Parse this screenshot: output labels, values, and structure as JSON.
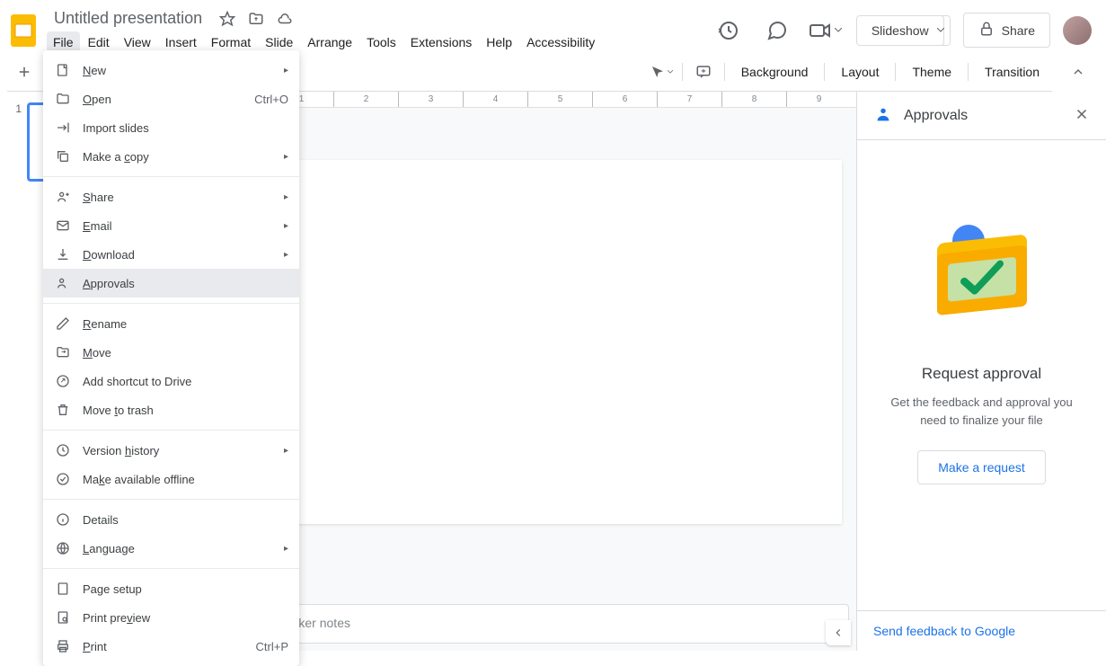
{
  "doc": {
    "title": "Untitled presentation"
  },
  "menubar": {
    "items": [
      "File",
      "Edit",
      "View",
      "Insert",
      "Format",
      "Slide",
      "Arrange",
      "Tools",
      "Extensions",
      "Help",
      "Accessibility"
    ]
  },
  "header_buttons": {
    "slideshow": "Slideshow",
    "share": "Share"
  },
  "toolbar": {
    "background": "Background",
    "layout": "Layout",
    "theme": "Theme",
    "transition": "Transition"
  },
  "file_menu": {
    "new": "New",
    "open": "Open",
    "open_shortcut": "Ctrl+O",
    "import_slides": "Import slides",
    "make_a_copy": "Make a copy",
    "share": "Share",
    "email": "Email",
    "download": "Download",
    "approvals": "Approvals",
    "rename": "Rename",
    "move": "Move",
    "add_shortcut": "Add shortcut to Drive",
    "move_to_trash": "Move to trash",
    "version_history": "Version history",
    "make_available_offline": "Make available offline",
    "details": "Details",
    "language": "Language",
    "page_setup": "Page setup",
    "print_preview": "Print preview",
    "print": "Print",
    "print_shortcut": "Ctrl+P"
  },
  "slide_panel": {
    "slide_number": "1"
  },
  "ruler": [
    "1",
    "2",
    "3",
    "4",
    "5",
    "6",
    "7",
    "8",
    "9"
  ],
  "speaker_notes": {
    "placeholder": "Click to add speaker notes"
  },
  "approvals_panel": {
    "title": "Approvals",
    "heading": "Request approval",
    "description": "Get the feedback and approval you need to finalize your file",
    "button": "Make a request",
    "feedback_link": "Send feedback to Google"
  }
}
